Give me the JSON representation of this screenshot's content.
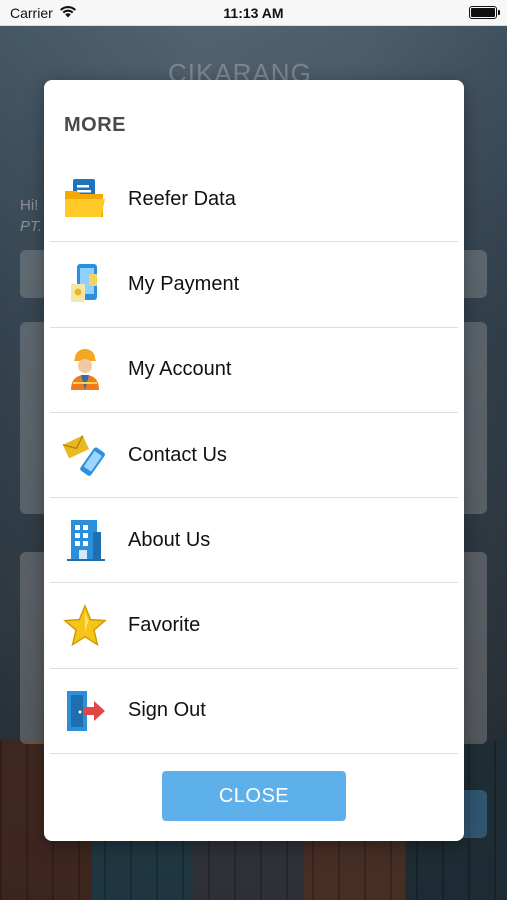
{
  "status_bar": {
    "carrier": "Carrier",
    "time": "11:13 AM",
    "battery_level": 1.0
  },
  "background": {
    "logo_text": "CIKARANG",
    "greeting": "Hi!",
    "company_prefix": "PT."
  },
  "modal": {
    "title": "MORE",
    "items": [
      {
        "label": "Reefer Data",
        "icon": "folder-document-icon"
      },
      {
        "label": "My Payment",
        "icon": "payment-phone-icon"
      },
      {
        "label": "My Account",
        "icon": "worker-avatar-icon"
      },
      {
        "label": "Contact Us",
        "icon": "mail-phone-icon"
      },
      {
        "label": "About Us",
        "icon": "building-icon"
      },
      {
        "label": "Favorite",
        "icon": "star-icon"
      },
      {
        "label": "Sign Out",
        "icon": "exit-door-icon"
      }
    ],
    "close_label": "CLOSE"
  },
  "colors": {
    "close_button": "#5eb0ea",
    "title": "#4a4a4a",
    "divider": "#dedede"
  }
}
